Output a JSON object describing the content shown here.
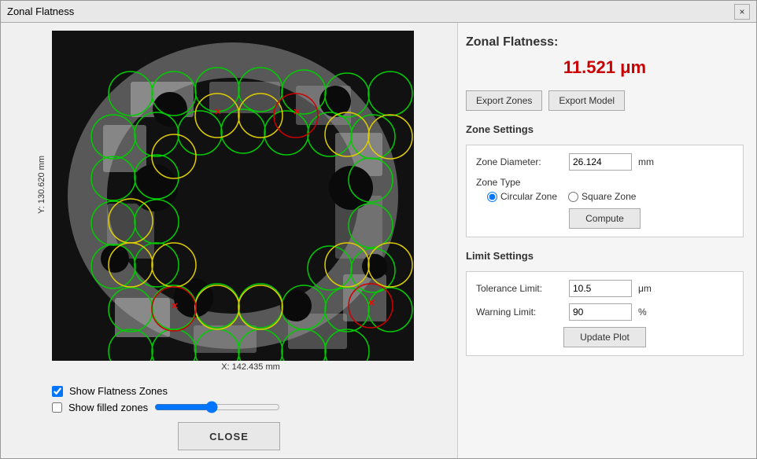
{
  "window": {
    "title": "Zonal Flatness",
    "close_label": "×"
  },
  "visualization": {
    "y_label": "Y: 130.620 mm",
    "x_label": "X: 142.435 mm"
  },
  "right_panel": {
    "title": "Zonal Flatness:",
    "value": "11.521 μm",
    "export_zones_label": "Export Zones",
    "export_model_label": "Export Model",
    "zone_settings_label": "Zone Settings",
    "zone_diameter_label": "Zone Diameter:",
    "zone_diameter_value": "26.124",
    "zone_diameter_unit": "mm",
    "zone_type_label": "Zone Type",
    "circular_zone_label": "Circular Zone",
    "square_zone_label": "Square Zone",
    "compute_label": "Compute",
    "limit_settings_label": "Limit Settings",
    "tolerance_limit_label": "Tolerance Limit:",
    "tolerance_limit_value": "10.5",
    "tolerance_limit_unit": "μm",
    "warning_limit_label": "Warning Limit:",
    "warning_limit_value": "90",
    "warning_limit_unit": "%",
    "update_plot_label": "Update Plot"
  },
  "controls": {
    "show_flatness_zones_label": "Show Flatness Zones",
    "show_filled_zones_label": "Show filled zones",
    "show_flatness_checked": true,
    "show_filled_checked": false,
    "close_label": "CLOSE"
  }
}
